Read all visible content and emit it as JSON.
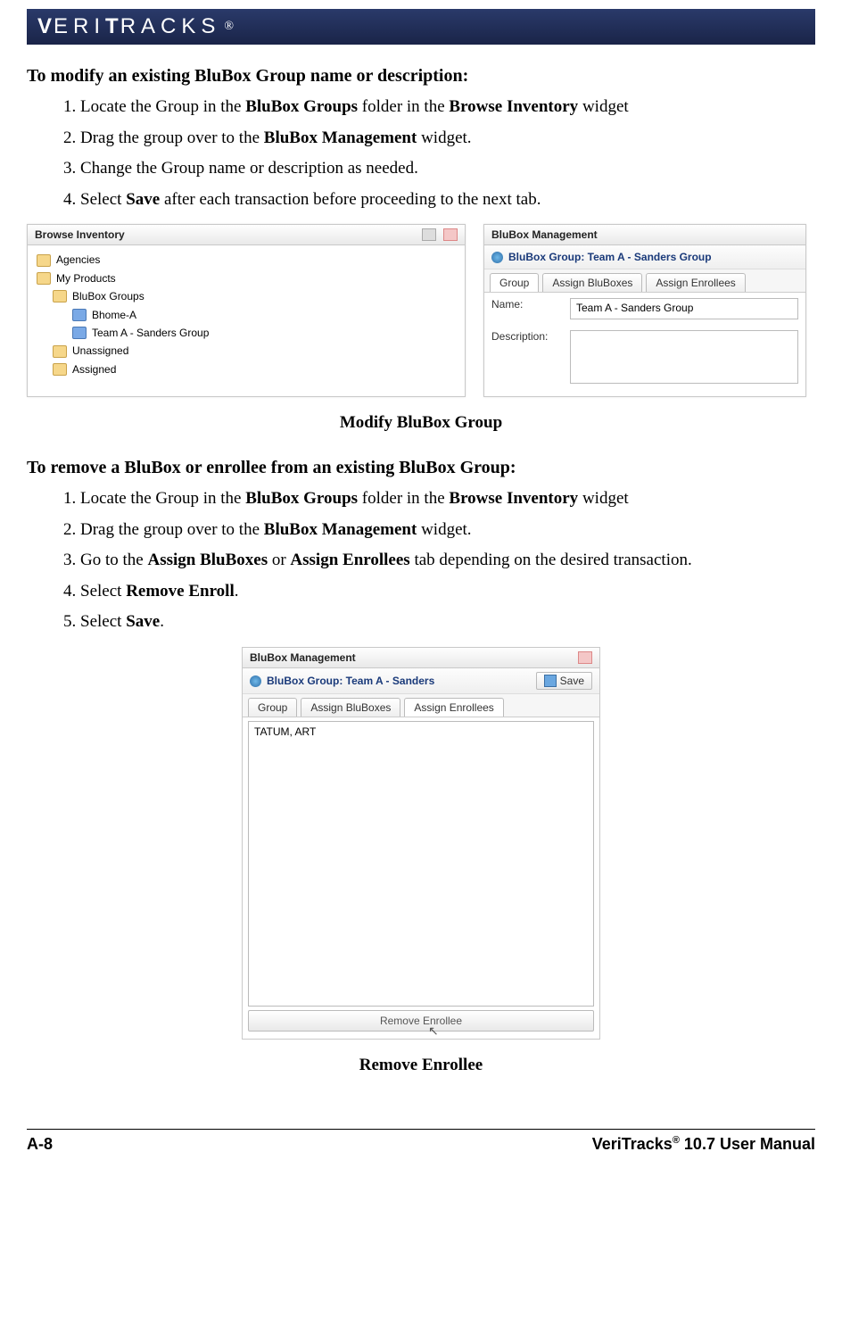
{
  "brand": "VERITRACKS",
  "brand_suffix": "®",
  "section1": {
    "heading": "To modify an existing BluBox Group name or description:",
    "steps": [
      {
        "pre": "Locate the Group in the ",
        "b1": "BluBox Groups",
        "mid": " folder in the ",
        "b2": "Browse Inventory",
        "post": " widget"
      },
      {
        "pre": "Drag the group over to the ",
        "b1": "BluBox Management",
        "post": " widget."
      },
      {
        "pre": "Change the Group name or description as needed."
      },
      {
        "pre": "Select ",
        "b1": "Save",
        "post": " after each transaction before proceeding to the next tab."
      }
    ]
  },
  "shot1": {
    "left_title": "Browse Inventory",
    "tree": {
      "agencies": "Agencies",
      "myproducts": "My Products",
      "blubox_groups": "BluBox Groups",
      "bhome": "Bhome-A",
      "teama": "Team A - Sanders Group",
      "unassigned": "Unassigned",
      "assigned": "Assigned"
    },
    "right_title": "BluBox Management",
    "group_label": "BluBox Group:  Team A - Sanders Group",
    "tabs": {
      "group": "Group",
      "assign_bb": "Assign BluBoxes",
      "assign_en": "Assign Enrollees"
    },
    "name_label": "Name:",
    "name_value": "Team A - Sanders Group",
    "desc_label": "Description:"
  },
  "caption1": "Modify BluBox Group",
  "section2": {
    "heading": "To remove a BluBox or enrollee from an existing BluBox Group:",
    "steps": [
      {
        "pre": "Locate the Group in the ",
        "b1": "BluBox Groups",
        "mid": " folder in the ",
        "b2": "Browse Inventory",
        "post": " widget"
      },
      {
        "pre": "Drag the group over to the ",
        "b1": "BluBox Management",
        "post": " widget."
      },
      {
        "pre": "Go to the ",
        "b1": "Assign BluBoxes",
        "mid": " or ",
        "b2": "Assign Enrollees",
        "post": " tab depending on the desired transaction."
      },
      {
        "pre": "Select ",
        "b1": "Remove Enroll",
        "post": "."
      },
      {
        "pre": "Select ",
        "b1": "Save",
        "post": "."
      }
    ]
  },
  "shot2": {
    "title": "BluBox Management",
    "group_label": "BluBox Group:  Team A - Sanders",
    "save": "Save",
    "tabs": {
      "group": "Group",
      "assign_bb": "Assign BluBoxes",
      "assign_en": "Assign Enrollees"
    },
    "entry": "TATUM, ART",
    "remove_btn": "Remove Enrollee"
  },
  "caption2": "Remove Enrollee",
  "footer": {
    "left": "A-8",
    "right_pre": "VeriTracks",
    "right_reg": "®",
    "right_post": " 10.7 User Manual"
  }
}
